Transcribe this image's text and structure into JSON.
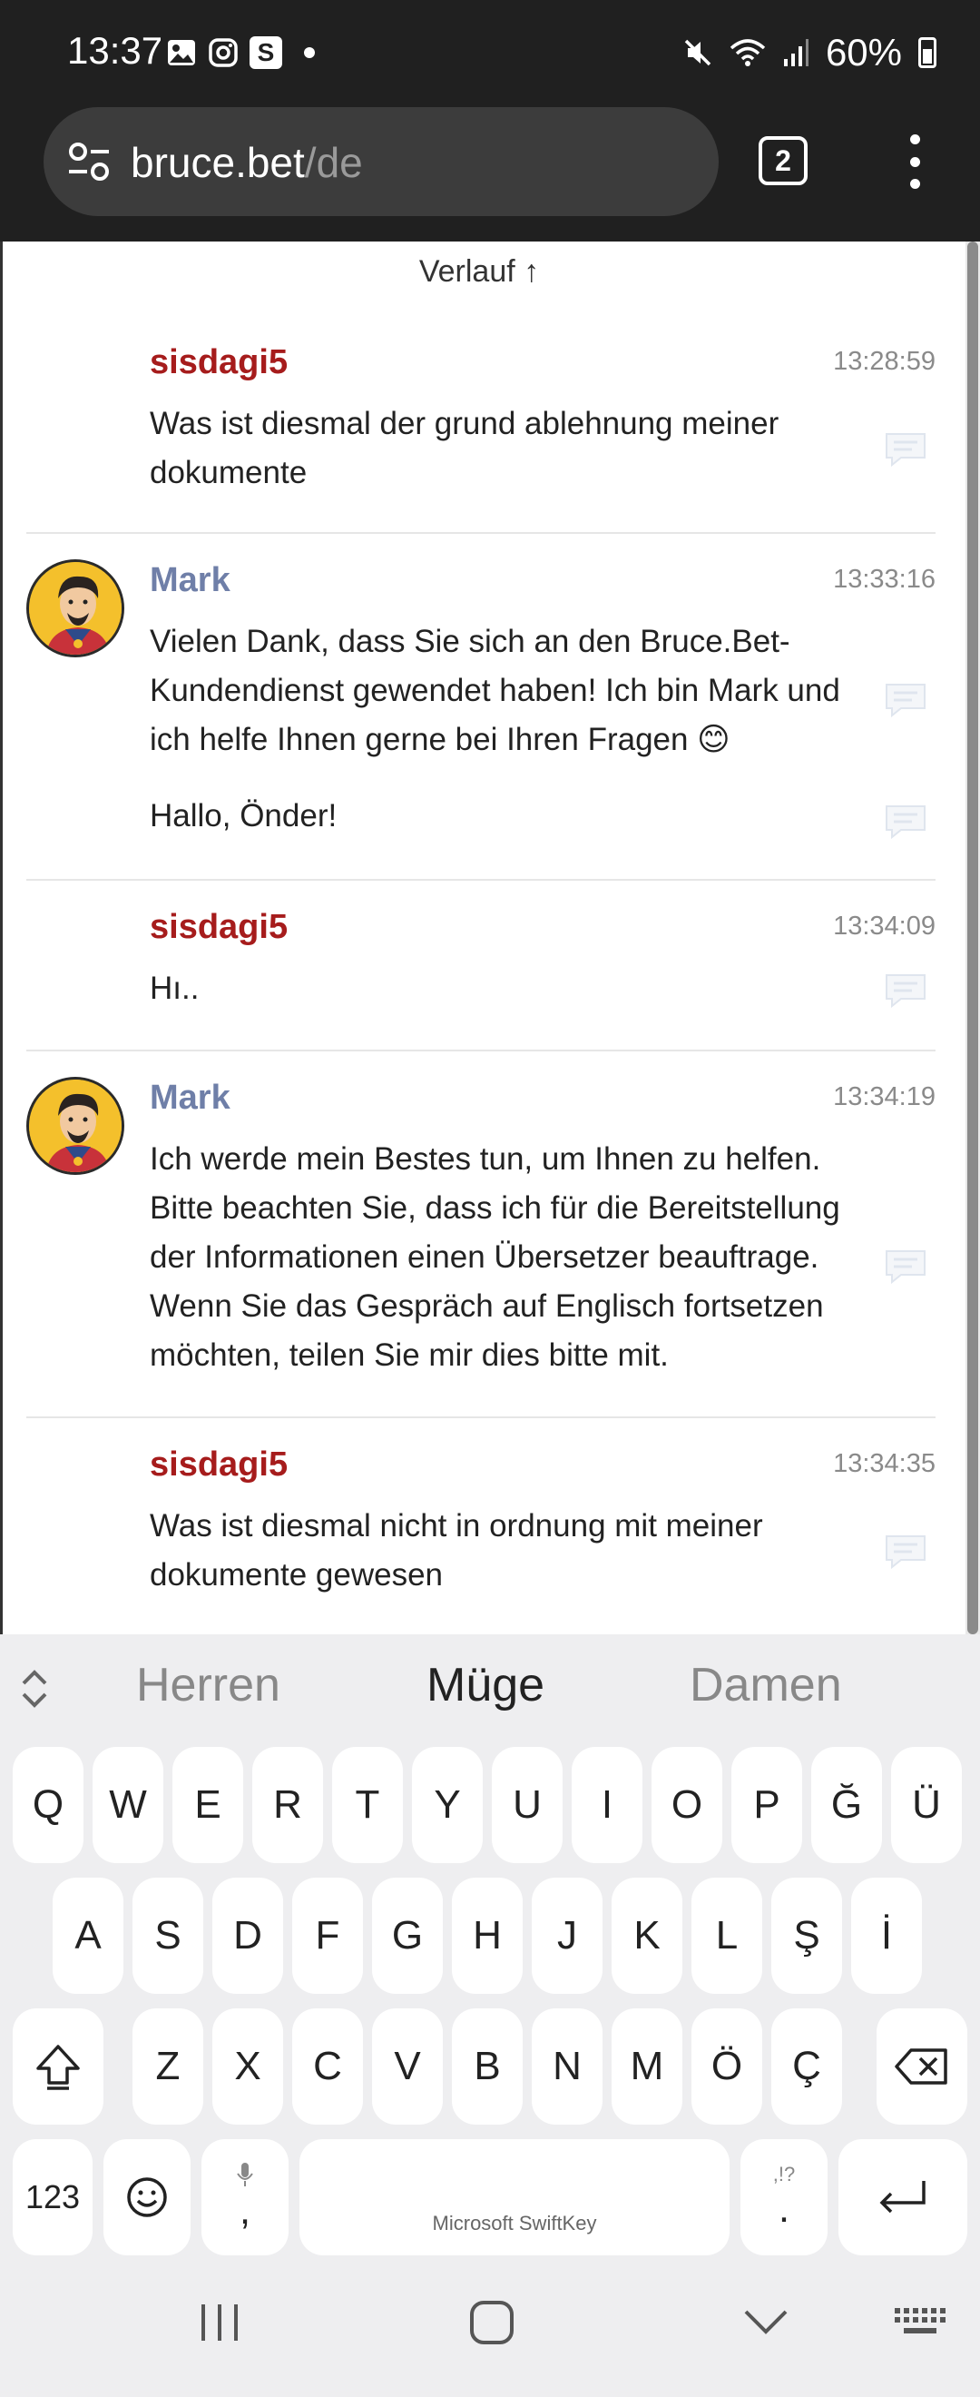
{
  "status_bar": {
    "time": "13:37",
    "app_badge": "S",
    "battery": "60%"
  },
  "browser": {
    "url_host": "bruce.bet",
    "url_path": "/de",
    "tab_count": "2"
  },
  "chat": {
    "history_label": "Verlauf ↑",
    "messages": [
      {
        "author": "sisdagi5",
        "time": "13:28:59",
        "texts": [
          "Was ist diesmal der grund ablehnung meiner dokumente"
        ]
      },
      {
        "author": "Mark",
        "time": "13:33:16",
        "texts": [
          "Vielen Dank, dass Sie sich an den Bruce.Bet-Kundendienst gewendet haben! Ich bin Mark und ich helfe Ihnen gerne bei Ihren Fragen 😊",
          "Hallo, Önder!"
        ]
      },
      {
        "author": "sisdagi5",
        "time": "13:34:09",
        "texts": [
          "Hı.."
        ]
      },
      {
        "author": "Mark",
        "time": "13:34:19",
        "texts": [
          "Ich werde mein Bestes tun, um Ihnen zu helfen. Bitte beachten Sie, dass ich für die Bereitstellung der Informationen einen Übersetzer beauftrage. Wenn Sie das Gespräch auf Englisch fortsetzen möchten, teilen Sie mir dies bitte mit."
        ]
      },
      {
        "author": "sisdagi5",
        "time": "13:34:35",
        "texts": [
          "Was ist diesmal nicht in ordnung mit meiner dokumente gewesen"
        ]
      }
    ]
  },
  "keyboard": {
    "suggestions": [
      "Herren",
      "Müge",
      "Damen"
    ],
    "row1": [
      "Q",
      "W",
      "E",
      "R",
      "T",
      "Y",
      "U",
      "I",
      "O",
      "P",
      "Ğ",
      "Ü"
    ],
    "row2": [
      "A",
      "S",
      "D",
      "F",
      "G",
      "H",
      "J",
      "K",
      "L",
      "Ş",
      "İ"
    ],
    "row3": [
      "Z",
      "X",
      "C",
      "V",
      "B",
      "N",
      "M",
      "Ö",
      "Ç"
    ],
    "numbers_key": "123",
    "comma_key": ",",
    "space_label": "Microsoft SwiftKey",
    "period_key": ".",
    "punct_hint": ",!?"
  }
}
